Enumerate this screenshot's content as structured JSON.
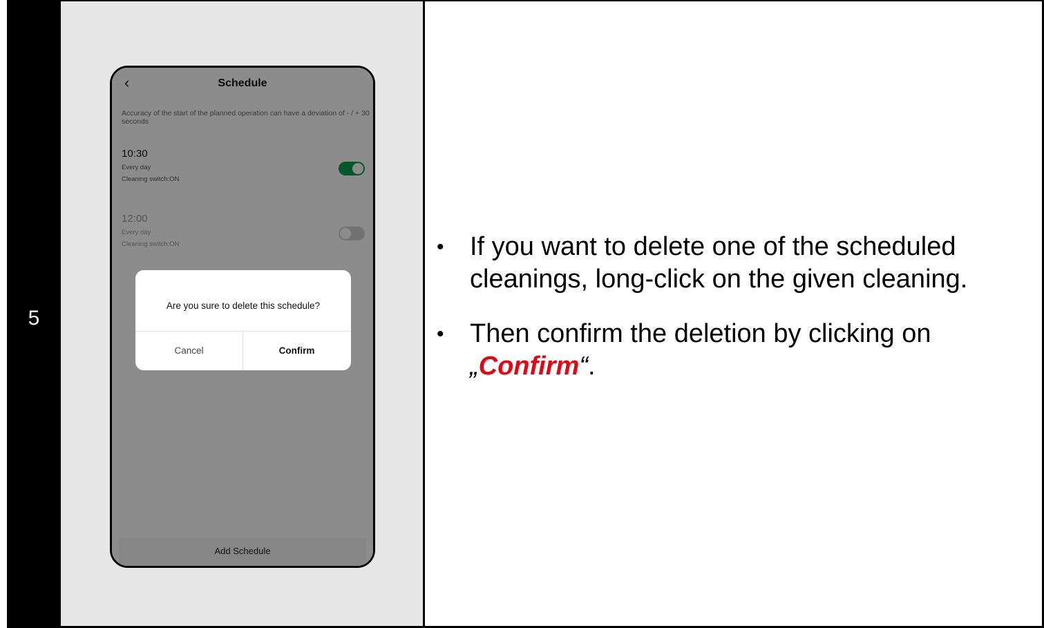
{
  "step": {
    "number": "5"
  },
  "phone": {
    "header": {
      "back_icon": "‹",
      "title": "Schedule"
    },
    "notice": "Accuracy of the start of the planned operation can have a deviation of - / + 30 seconds",
    "schedules": [
      {
        "time": "10:30",
        "days": "Every day",
        "switch": "Cleaning switch:ON",
        "enabled": true
      },
      {
        "time": "12:00",
        "days": "Every day",
        "switch": "Cleaning switch:ON",
        "enabled": false
      }
    ],
    "add_button": "Add Schedule",
    "dialog": {
      "message": "Are you sure to delete this schedule?",
      "cancel": "Cancel",
      "confirm": "Confirm"
    }
  },
  "instructions": {
    "bullet_char": "•",
    "item1": "If you want to delete one of the scheduled cleanings, long-click on the given cleaning.",
    "item2_prefix": "Then confirm the deletion by clicking on ",
    "open_quote": "„",
    "item2_keyword": "Confirm",
    "close_quote": "“",
    "item2_suffix": "."
  },
  "colors": {
    "toggle_on": "#0aa14b",
    "keyword": "#e30613",
    "step_background": "#000000",
    "panel_background": "#e7e7e7"
  }
}
